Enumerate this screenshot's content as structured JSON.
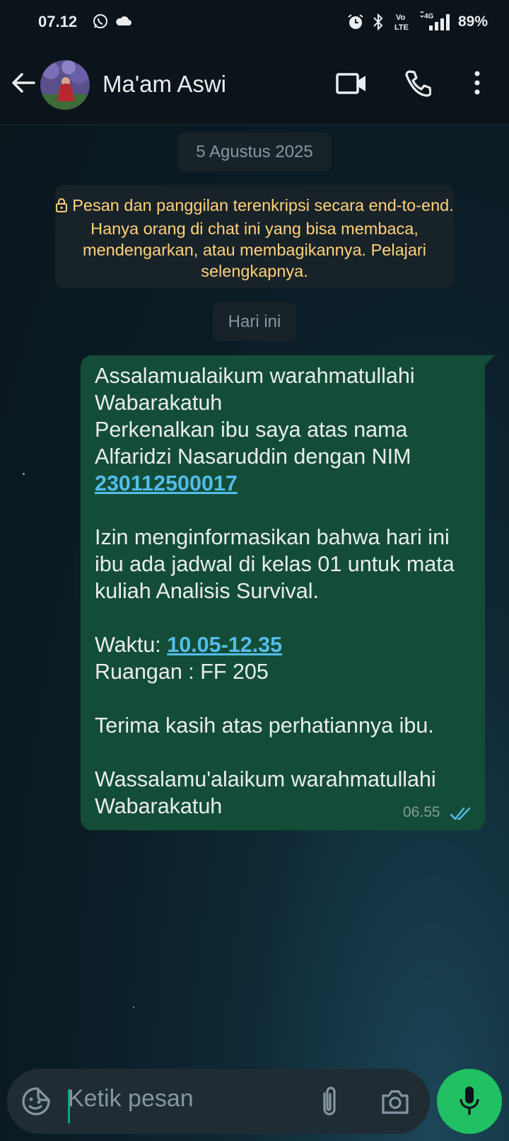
{
  "status_bar": {
    "time": "07.12",
    "icons": [
      "whatsapp-icon",
      "cloud-icon",
      "alarm-icon",
      "bluetooth-icon",
      "volte-icon",
      "4g-icon",
      "signal-icon"
    ],
    "network_volte": "Vo LTE",
    "network_type": "4G",
    "battery": "89%"
  },
  "header": {
    "contact_name": "Ma'am Aswi",
    "icons": [
      "back-arrow-icon",
      "video-call-icon",
      "voice-call-icon",
      "more-options-icon"
    ]
  },
  "chat": {
    "date_chip": "5 Agustus 2025",
    "encryption_notice": "Pesan dan panggilan terenkripsi secara end-to-end. Hanya orang di chat ini yang bisa membaca, mendengarkan, atau membagikannya. Pelajari selengkapnya.",
    "today_chip": "Hari ini",
    "message": {
      "line1": "Assalamualaikum warahmatullahi Wabarakatuh",
      "line2": "Perkenalkan ibu saya atas nama Alfaridzi Nasaruddin dengan NIM",
      "nim": "230112500017",
      "line3": "Izin menginformasikan bahwa hari ini ibu ada jadwal di kelas 01 untuk mata kuliah Analisis Survival.",
      "time_label": "Waktu: ",
      "time_value": "10.05-12.35",
      "room": "Ruangan : FF 205",
      "thanks": "Terima kasih atas perhatiannya ibu.",
      "closing": "Wassalamu'alaikum warahmatullahi Wabarakatuh",
      "sent_time": "06.55",
      "status": "read"
    }
  },
  "input": {
    "placeholder": "Ketik pesan",
    "icons": [
      "sticker-icon",
      "attach-icon",
      "camera-icon",
      "mic-icon"
    ]
  },
  "colors": {
    "accent": "#21c063",
    "bubble": "#144d37",
    "link": "#53bdeb",
    "notice": "#ffd279"
  }
}
